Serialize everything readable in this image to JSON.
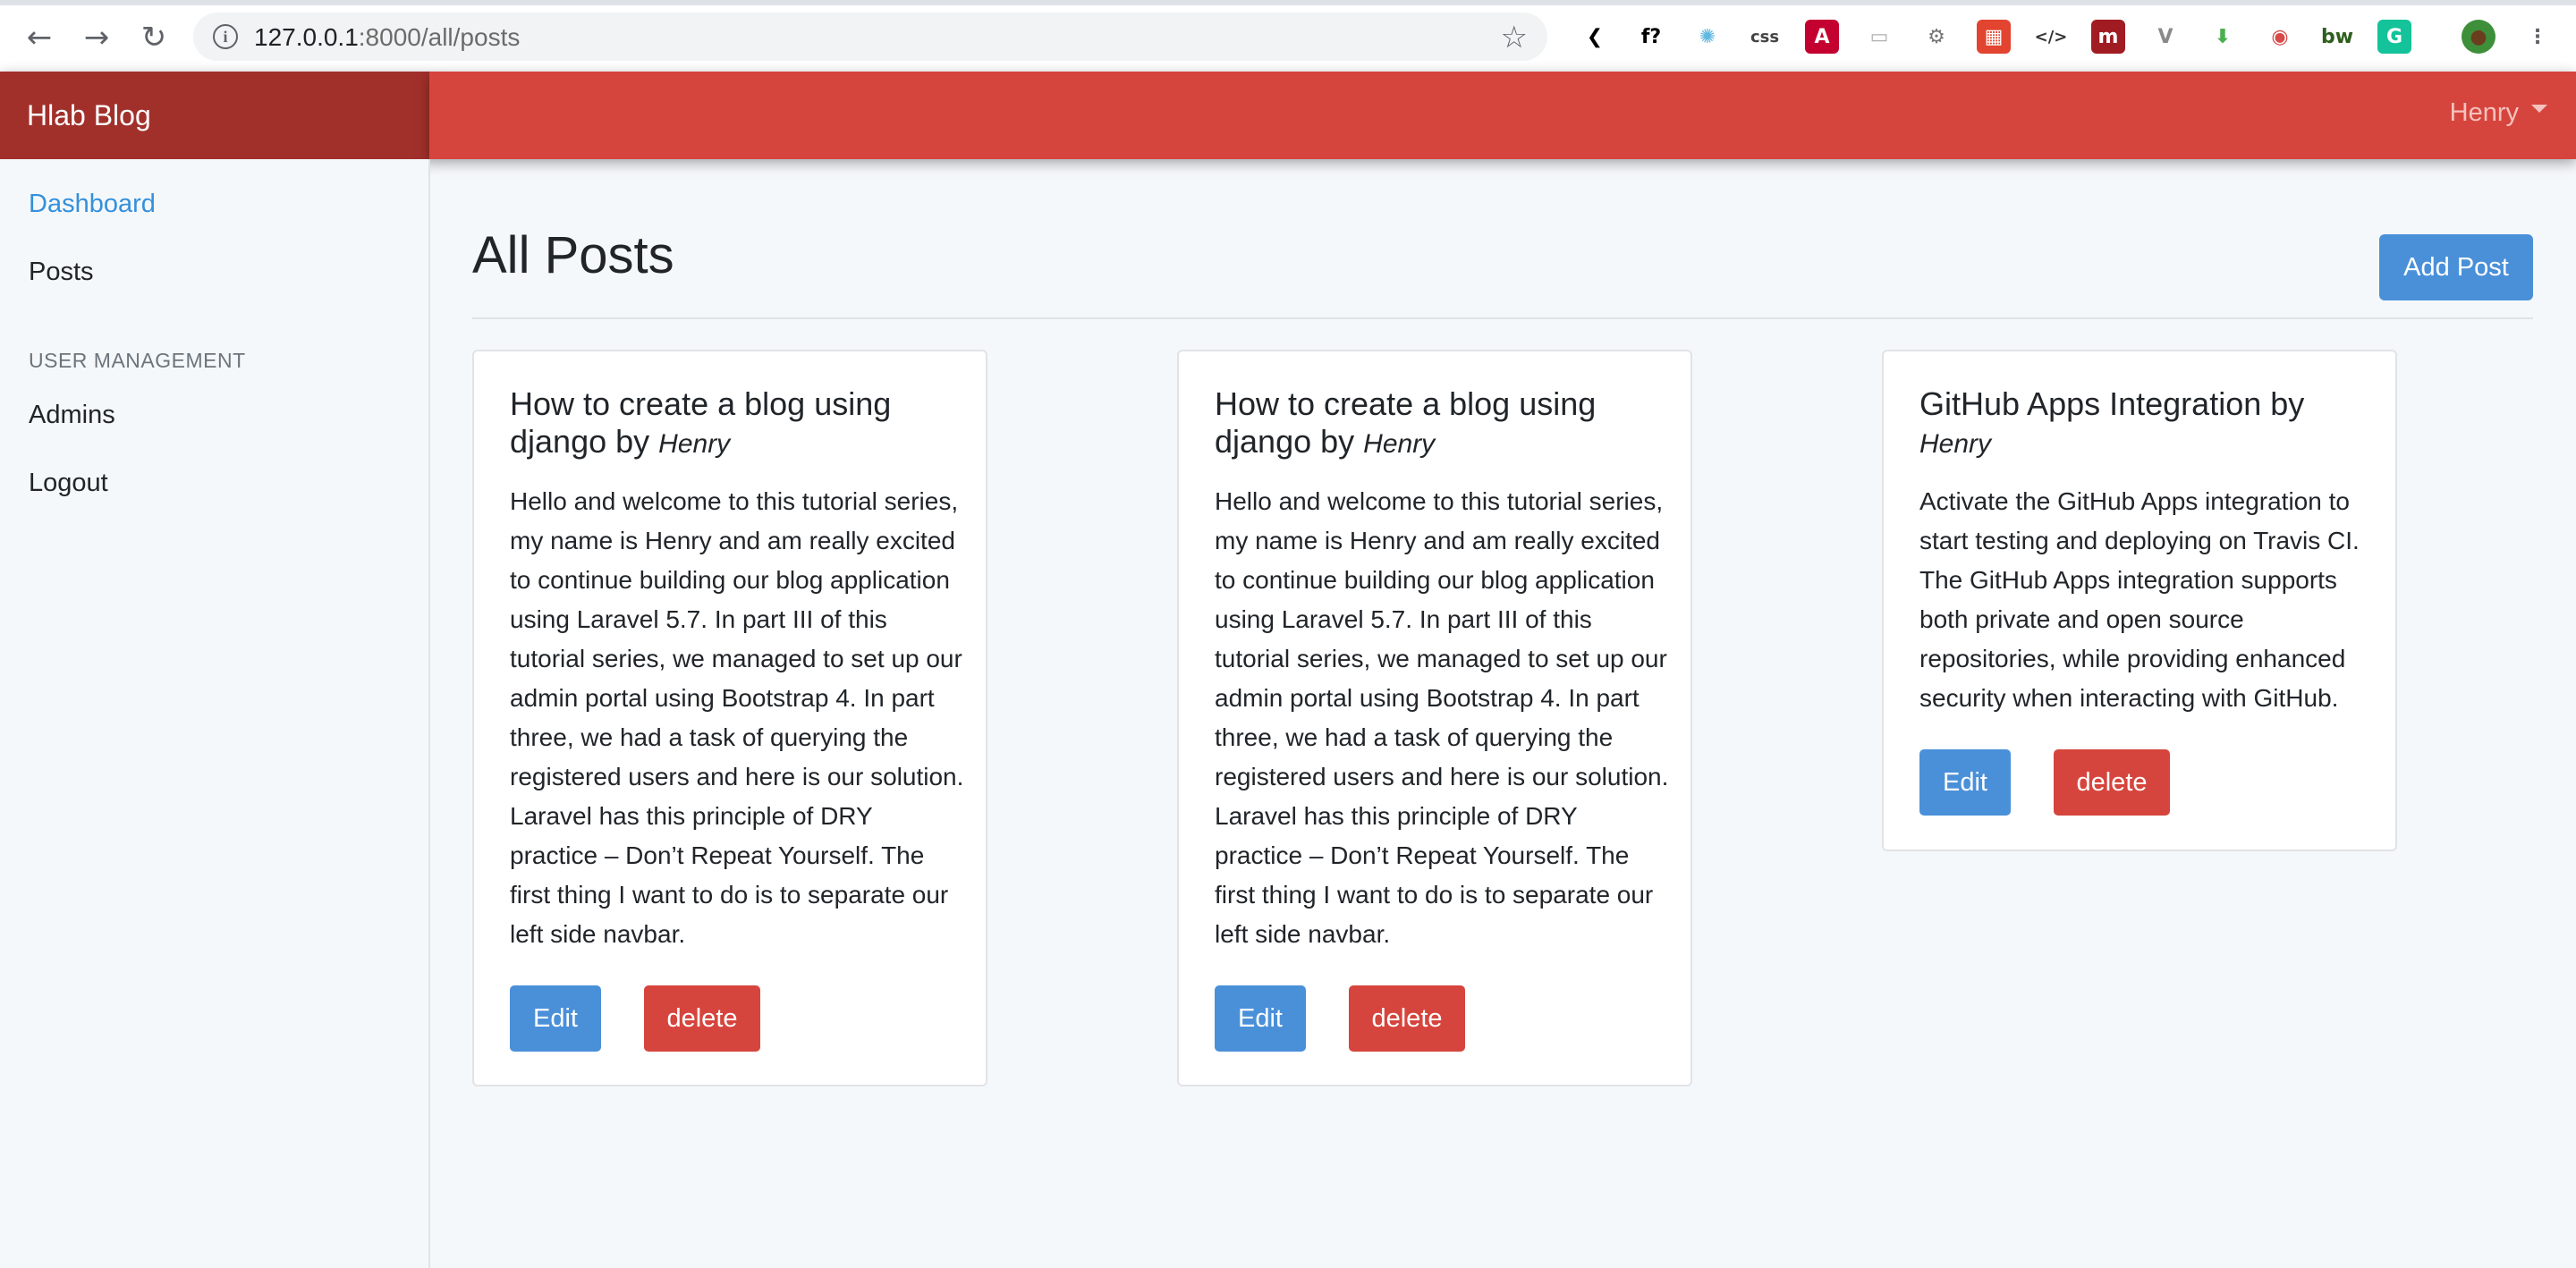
{
  "browser": {
    "url_host": "127.0.0.1",
    "url_path": ":8000/all/posts",
    "back_icon": "arrow-left",
    "forward_icon": "arrow-right",
    "reload_icon": "reload",
    "extensions": [
      {
        "name": "bracket-icon",
        "glyph": "❮",
        "color": "#000000",
        "bg": "transparent"
      },
      {
        "name": "fquestion-icon",
        "glyph": "f?",
        "color": "#000000",
        "bg": "transparent"
      },
      {
        "name": "react-icon",
        "glyph": "✺",
        "color": "#61b8e0",
        "bg": "transparent"
      },
      {
        "name": "css-icon",
        "glyph": "css",
        "color": "#444444",
        "bg": "transparent"
      },
      {
        "name": "angular-icon",
        "glyph": "A",
        "color": "#ffffff",
        "bg": "#c3002f"
      },
      {
        "name": "window-icon",
        "glyph": "▭",
        "color": "#b0b0b0",
        "bg": "transparent"
      },
      {
        "name": "gear-icon",
        "glyph": "⚙",
        "color": "#777777",
        "bg": "transparent"
      },
      {
        "name": "laravel-icon",
        "glyph": "▦",
        "color": "#ffffff",
        "bg": "#e2442f"
      },
      {
        "name": "code-icon",
        "glyph": "</>",
        "color": "#333333",
        "bg": "transparent"
      },
      {
        "name": "m-icon",
        "glyph": "m",
        "color": "#ffffff",
        "bg": "#a01c22"
      },
      {
        "name": "vue-icon",
        "glyph": "V",
        "color": "#8a8a8a",
        "bg": "transparent"
      },
      {
        "name": "download-icon",
        "glyph": "⬇",
        "color": "#4caf50",
        "bg": "transparent"
      },
      {
        "name": "lens-icon",
        "glyph": "◉",
        "color": "#d84a4a",
        "bg": "transparent"
      },
      {
        "name": "bw-icon",
        "glyph": "bw",
        "color": "#2e5e1e",
        "bg": "transparent"
      },
      {
        "name": "grammarly-icon",
        "glyph": "G",
        "color": "#ffffff",
        "bg": "#15c39a"
      },
      {
        "name": "avatar-icon",
        "glyph": "●",
        "color": "#6b3d1f",
        "bg": "#3e8f3a"
      },
      {
        "name": "kebab-menu-icon",
        "glyph": "⋮",
        "color": "#5f6368",
        "bg": "transparent"
      }
    ]
  },
  "app": {
    "brand": "Hlab Blog",
    "user": "Henry"
  },
  "sidebar": {
    "items": [
      {
        "label": "Dashboard"
      },
      {
        "label": "Posts"
      }
    ],
    "section_heading": "USER MANAGEMENT",
    "section_items": [
      {
        "label": "Admins"
      },
      {
        "label": "Logout"
      }
    ]
  },
  "page": {
    "title": "All Posts",
    "add_button": "Add Post"
  },
  "posts": [
    {
      "title": "How to create a blog using django by",
      "author": "Henry",
      "body": "Hello and welcome to this tutorial series, my name is Henry and am really excited to continue building our blog application using Laravel 5.7. In part III of this tutorial series, we managed to set up our admin portal using Bootstrap 4. In part three, we had a task of querying the registered users and here is our solution. Laravel has this principle of DRY practice – Don’t Repeat Yourself. The first thing I want to do is to separate our left side navbar.",
      "edit_label": "Edit",
      "delete_label": "delete"
    },
    {
      "title": "How to create a blog using django by",
      "author": "Henry",
      "body": "Hello and welcome to this tutorial series, my name is Henry and am really excited to continue building our blog application using Laravel 5.7. In part III of this tutorial series, we managed to set up our admin portal using Bootstrap 4. In part three, we had a task of querying the registered users and here is our solution. Laravel has this principle of DRY practice – Don’t Repeat Yourself. The first thing I want to do is to separate our left side navbar.",
      "edit_label": "Edit",
      "delete_label": "delete"
    },
    {
      "title": "GitHub Apps Integration by",
      "author": "Henry",
      "body": "Activate the GitHub Apps integration to start testing and deploying on Travis CI. The GitHub Apps integration supports both private and open source repositories, while providing enhanced security when interacting with GitHub.",
      "edit_label": "Edit",
      "delete_label": "delete"
    }
  ]
}
